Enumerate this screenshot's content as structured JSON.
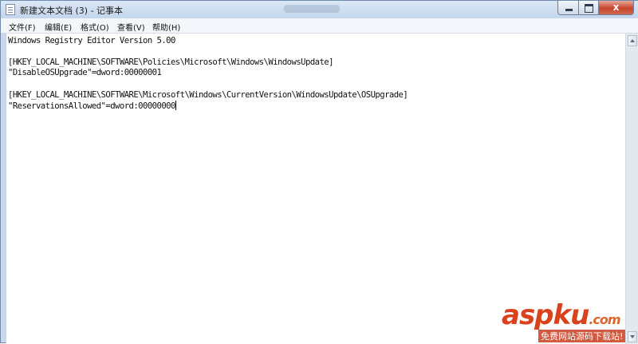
{
  "window": {
    "title": "新建文本文档 (3) - 记事本",
    "close_glyph": "x"
  },
  "menu": {
    "items": [
      {
        "label": "文件(F)"
      },
      {
        "label": "编辑(E)"
      },
      {
        "label": "格式(O)"
      },
      {
        "label": "查看(V)"
      },
      {
        "label": "帮助(H)"
      }
    ]
  },
  "document": {
    "lines": [
      "Windows Registry Editor Version 5.00",
      "",
      "[HKEY_LOCAL_MACHINE\\SOFTWARE\\Policies\\Microsoft\\Windows\\WindowsUpdate]",
      "\"DisableOSUpgrade\"=dword:00000001",
      "",
      "[HKEY_LOCAL_MACHINE\\SOFTWARE\\Microsoft\\Windows\\CurrentVersion\\WindowsUpdate\\OSUpgrade]",
      "\"ReservationsAllowed\"=dword:00000000"
    ]
  },
  "watermark": {
    "logo": "aspku",
    "logo_tld": ".com",
    "tagline": "免费网站源码下载站!"
  },
  "icons": {
    "app": "notepad-icon",
    "minimize": "minimize-icon",
    "maximize": "maximize-icon",
    "close": "close-icon",
    "scroll_up": "arrow-up-icon",
    "scroll_down": "arrow-down-icon"
  },
  "colors": {
    "titlebar": "#c4d6ec",
    "close_button": "#c8432c",
    "watermark": "#d9421c"
  }
}
